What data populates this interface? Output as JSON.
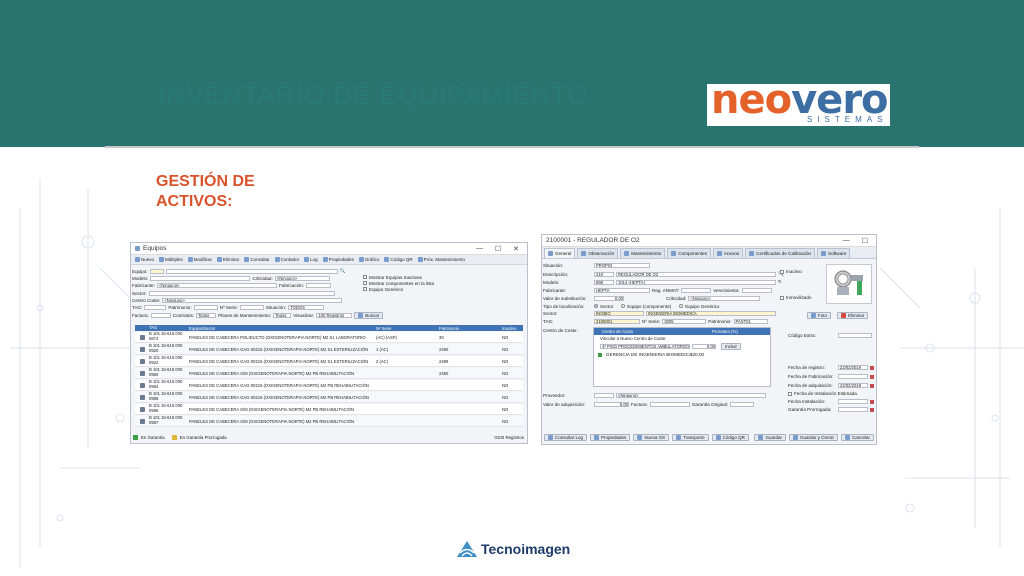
{
  "banner": {
    "title": "INVENTARIO DE EQUIPAMIENTO"
  },
  "logo": {
    "main_prefix": "ne",
    "main_o1": "o",
    "main_v": "v",
    "main_e": "e",
    "main_r": "r",
    "main_o2": "o",
    "sub": "SISTEMAS"
  },
  "section": {
    "title": "GESTIÓN DE\nACTIVOS:"
  },
  "win1": {
    "title": "Equipos",
    "toolbar": [
      "Nuevo",
      "Múltiples",
      "Modificar",
      "Eliminar",
      "Consultar",
      "Contador",
      "Log",
      "Propiedades",
      "Gráfico",
      "Código QR",
      "Próx. Mantenimiento"
    ],
    "labels": {
      "equipo": "Equipo:",
      "modelo": "Modelo:",
      "fabricante": "Fabricante:",
      "sector": "Sector:",
      "centro": "Centro Coste:",
      "tag": "TAG:",
      "factura": "Factura:",
      "criticidad": "Criticidad:",
      "fabricacion": "Fabricación:",
      "patrimonio": "Patrimonio:",
      "nserie": "Nº Serie:",
      "situacion": "Situación:",
      "contratos": "Contratos:",
      "planes": "Planes de Mantenimiento:",
      "visualizar": "Visualizar:"
    },
    "values": {
      "criticidad": "<Ninguno>",
      "fabricante": "<Ninguno>",
      "centro": "<Ninguno>",
      "situacion": "TODOS",
      "contratos": "Todos",
      "planes": "Todos",
      "visualizar": "100 Registros"
    },
    "checks": [
      "Mostrar Equipos Inactivos",
      "Mostrar componentes en la lista",
      "Equipo Genérico"
    ],
    "buscar": "Buscar",
    "columns": [
      "TAG",
      "Equipo/Sector",
      "Nº Serie",
      "Patrimonio",
      "Inactivo"
    ],
    "rows": [
      {
        "tag": "B 101 15-616 000\n0874",
        "equipo": "PANELES DE CABECERA POLIDUCTO (OXIGENOTERAPIA NORTE) M2 S1 LABORATORIO",
        "serie": "(AC) (ASP)",
        "patrimonio": "39",
        "inactivo": "NO"
      },
      {
        "tag": "B 101 15-616 000\n0920",
        "equipo": "PANELES DE CABECERA GAG-00215 (OXIGENOTERAPIA NORTE) M2 S1 ESTERILIZACIÓN",
        "serie": "1 (AC)",
        "patrimonio": "2490",
        "inactivo": "NO"
      },
      {
        "tag": "B 101 15-616 000\n0922",
        "equipo": "PANELES DE CABECERA GAG-00215 (OXIGENOTERAPIA NORTE) M2 S1 ESTERILIZACIÓN",
        "serie": "2 (AC)",
        "patrimonio": "2489",
        "inactivo": "NO"
      },
      {
        "tag": "B 101 15-616 000\n0960",
        "equipo": "PANELES DE CABECERA S/M (OXIGENOTERAPIA NORTE) M2 PB REHABILITACIÓN",
        "serie": "",
        "patrimonio": "2450",
        "inactivo": "NO"
      },
      {
        "tag": "B 101 15-616 000\n0984",
        "equipo": "PANELES DE CABECERA GAG-00216 (OXIGENOTERAPIA NORTE) M2 PB REHABILITACIÓN",
        "serie": "",
        "patrimonio": "",
        "inactivo": "NO"
      },
      {
        "tag": "B 101 15-616 000\n0985",
        "equipo": "PANELES DE CABECERA GAG-00216 (OXIGENOTERAPIA NORTE) M2 PB REHABILITACIÓN",
        "serie": "",
        "patrimonio": "",
        "inactivo": "NO"
      },
      {
        "tag": "B 101 15-616 000\n0986",
        "equipo": "PANELES DE CABECERA S/M (OXIGENOTERAPIA NORTE) M2 PB REHABILITACIÓN",
        "serie": "",
        "patrimonio": "",
        "inactivo": "NO"
      },
      {
        "tag": "B 101 15-616 000\n0987",
        "equipo": "PANELES DE CABECERA S/M (OXIGENOTERAPIA NORTE) M2 PB REHABILITACIÓN",
        "serie": "",
        "patrimonio": "",
        "inactivo": "NO"
      }
    ],
    "status": {
      "garantia": "En Garantía",
      "prorrogada": "En Garantía Prorrogada",
      "count": "0100 Registros"
    },
    "colors": {
      "garantia": "#3aa047",
      "prorrogada": "#e0b838"
    }
  },
  "win2": {
    "title": "2100001 - REGULADOR DE O2",
    "tabs": [
      "General",
      "Observación",
      "Mantenimiento",
      "Componentes",
      "Anexos",
      "Certificados de Calibración",
      "Software"
    ],
    "labels": {
      "situacion": "Situación:",
      "descripcion": "Descripción:",
      "modelo": "Modelo:",
      "fabricante": "Fabricante:",
      "valor_sust": "Valor de substitución:",
      "tipo_loc": "Tipo de localización:",
      "sector": "Sector:",
      "tag": "TAG:",
      "centro": "Centro de Coste:",
      "reg_anmat": "Reg. ANMAT:",
      "vencimiento": "Vencimiento:",
      "criticidad": "Criticidad:",
      "nserie": "Nº Serie:",
      "patrimonio": "Patrimonio:",
      "codigo_extra": "Código Extra:",
      "proveedor": "Proveedor:",
      "valor_adq": "Valor de adquisición:",
      "factura": "Factura:",
      "garantia_orig": "Garantía Original:",
      "fecha_registro": "Fecha de registro:",
      "fecha_fabricacion": "Fecha de Fabricación:",
      "fecha_adquisicion": "Fecha de adquisición:",
      "fecha_instalacion": "Fecha Instalación:",
      "garantia_prorrogada": "Garantía Prorrogada:"
    },
    "values": {
      "situacion": "PROPIO",
      "desc_code": "210",
      "desc_name": "REGULADOR DE O2",
      "modelo_code": "898",
      "modelo_name": "1014 (HEPTA)",
      "fabricante": "HEPTA",
      "valor_sust": "0,00",
      "criticidad": "<Ninguno>",
      "sector_code": "INGBIO",
      "sector_name": "INGENIERIA BIOMEDICA",
      "tag": "2100001",
      "nserie": "3005",
      "patrimonio": "PAST01",
      "proveedor": "<Ninguno>",
      "valor_adq": "5,00",
      "fecha_registro": "22/02/2019",
      "fecha_adquisicion": "22/02/2019"
    },
    "radios": [
      "Sector",
      "Equipo (componente)",
      "Equipo Genérico"
    ],
    "checks": {
      "inactivo": "Inactivo",
      "inmovilizado": "Inmovilizado",
      "instalacion": "Fecha de Instalación Estimada"
    },
    "photo_buttons": [
      "Foto",
      "Eliminar"
    ],
    "cost_grid": {
      "headers": [
        "Centro de Costo",
        "Prorrateo (%)"
      ],
      "link": "Vincular a Nuevo Centro de Coste:",
      "new_center": "4º PISO PROCEDIMIENTOS AMBULATORIOS",
      "new_pct": "0,00",
      "incluir": "Incluir",
      "row_name": "GERENCIA DE INGENIERIA BIOMEDICA",
      "row_pct": "100,00"
    },
    "footer": [
      "Consultar Log",
      "Propiedades",
      "Nueva OS",
      "Transporte",
      "Código QR"
    ],
    "footer_right": [
      "Guardar",
      "Guardar y Cerrar",
      "Cancelar"
    ]
  },
  "footer": {
    "brand": "Tecnoimagen"
  }
}
